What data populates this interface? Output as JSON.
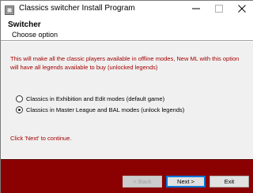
{
  "window": {
    "title": "Classics switcher Install Program",
    "icon": "installer-app-icon"
  },
  "header": {
    "title": "Switcher",
    "subtitle": "Choose option"
  },
  "content": {
    "description": "This will make all the classic players available in offline modes, New ML with this option will have all legends available to buy (unlocked legends)",
    "options": [
      {
        "label": "Classics in Exhibition and Edit modes (default game)",
        "selected": false
      },
      {
        "label": "Classics in Master League and BAL modes (unlock legends)",
        "selected": true
      }
    ],
    "hint": "Click 'Next' to continue."
  },
  "footer": {
    "back_label": "< Back",
    "next_label": "Next >",
    "exit_label": "Exit",
    "back_enabled": false
  },
  "colors": {
    "accent_text": "#a40000",
    "footer_bg": "#8b0000",
    "content_bg": "#f0f0f0"
  }
}
